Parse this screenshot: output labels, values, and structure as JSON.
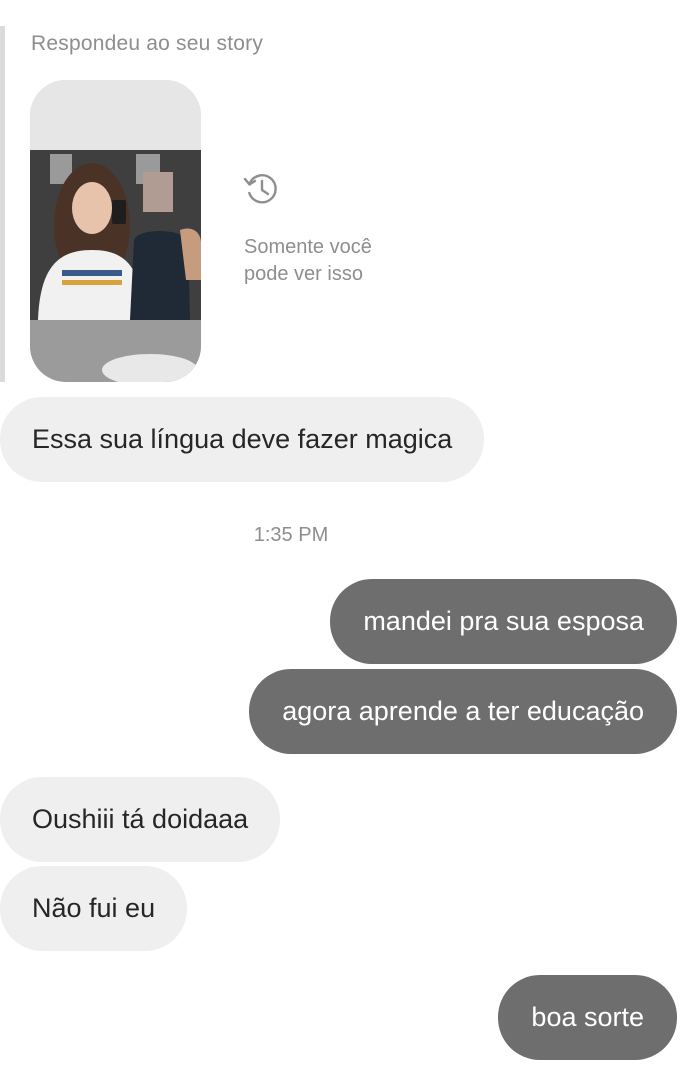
{
  "story_reply": {
    "caption": "Respondeu ao seu story",
    "thumbnail": "story-selfie-thumbnail",
    "visibility_icon": "history-clock-icon",
    "visibility_note": "Somente você pode ver isso"
  },
  "timestamp": "1:35 PM",
  "messages": [
    {
      "direction": "incoming",
      "text": "Essa sua língua deve fazer magica"
    },
    {
      "direction": "outgoing",
      "text": "mandei pra sua esposa"
    },
    {
      "direction": "outgoing",
      "text": "agora aprende a ter educação"
    },
    {
      "direction": "incoming",
      "text": "Oushiii tá doidaaa"
    },
    {
      "direction": "incoming",
      "text": "Não fui eu"
    },
    {
      "direction": "outgoing",
      "text": "boa sorte"
    }
  ],
  "colors": {
    "incoming_bubble": "#efefef",
    "outgoing_bubble": "#6e6e6e",
    "secondary_text": "#8e8e8e"
  }
}
